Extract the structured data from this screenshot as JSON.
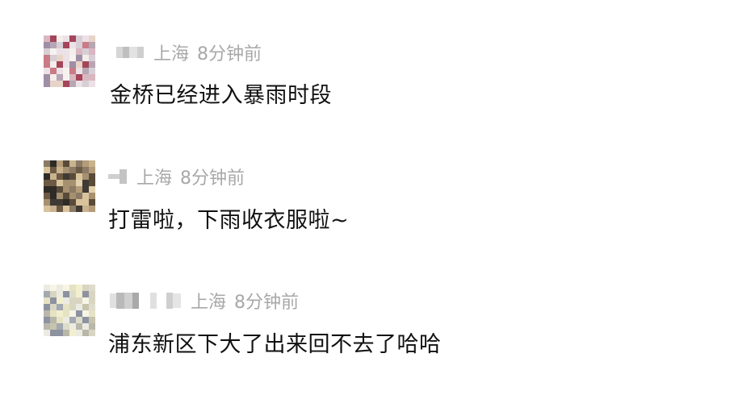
{
  "comments": [
    {
      "location": "上海",
      "time": "8分钟前",
      "text": "金桥已经进入暴雨时段"
    },
    {
      "location": "上海",
      "time": "8分钟前",
      "text": "打雷啦，下雨收衣服啦~"
    },
    {
      "location": "上海",
      "time": "8分钟前",
      "text": "浦东新区下大了出来回不去了哈哈"
    }
  ]
}
